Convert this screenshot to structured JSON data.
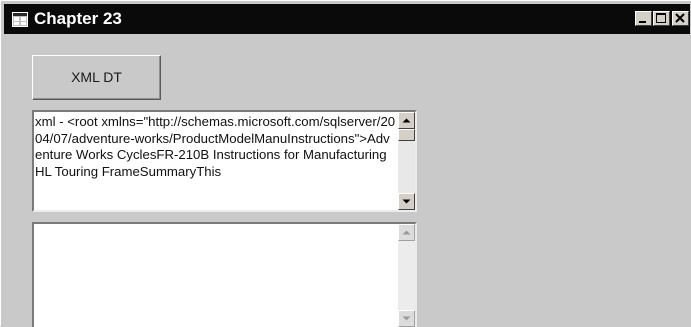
{
  "window": {
    "title": "Chapter 23",
    "icons": {
      "app": "app-window-icon",
      "minimize": "minimize-icon",
      "maximize": "maximize-icon",
      "close": "close-icon"
    }
  },
  "form": {
    "xml_button_label": "XML DT",
    "output_textbox": {
      "text": "xml - <root xmlns=\"http://schemas.microsoft.com/sqlserver/2004/07/adventure-works/ProductModelManuInstructions\">Adventure Works CyclesFR-210B Instructions for Manufacturing HL Touring FrameSummaryThis",
      "scrollbar": "enabled"
    },
    "input_textbox": {
      "text": "",
      "scrollbar": "disabled"
    }
  },
  "colors": {
    "titlebar": "#0a0a0a",
    "window_bg": "#c9c9c9",
    "textbox_bg": "#ffffff"
  }
}
